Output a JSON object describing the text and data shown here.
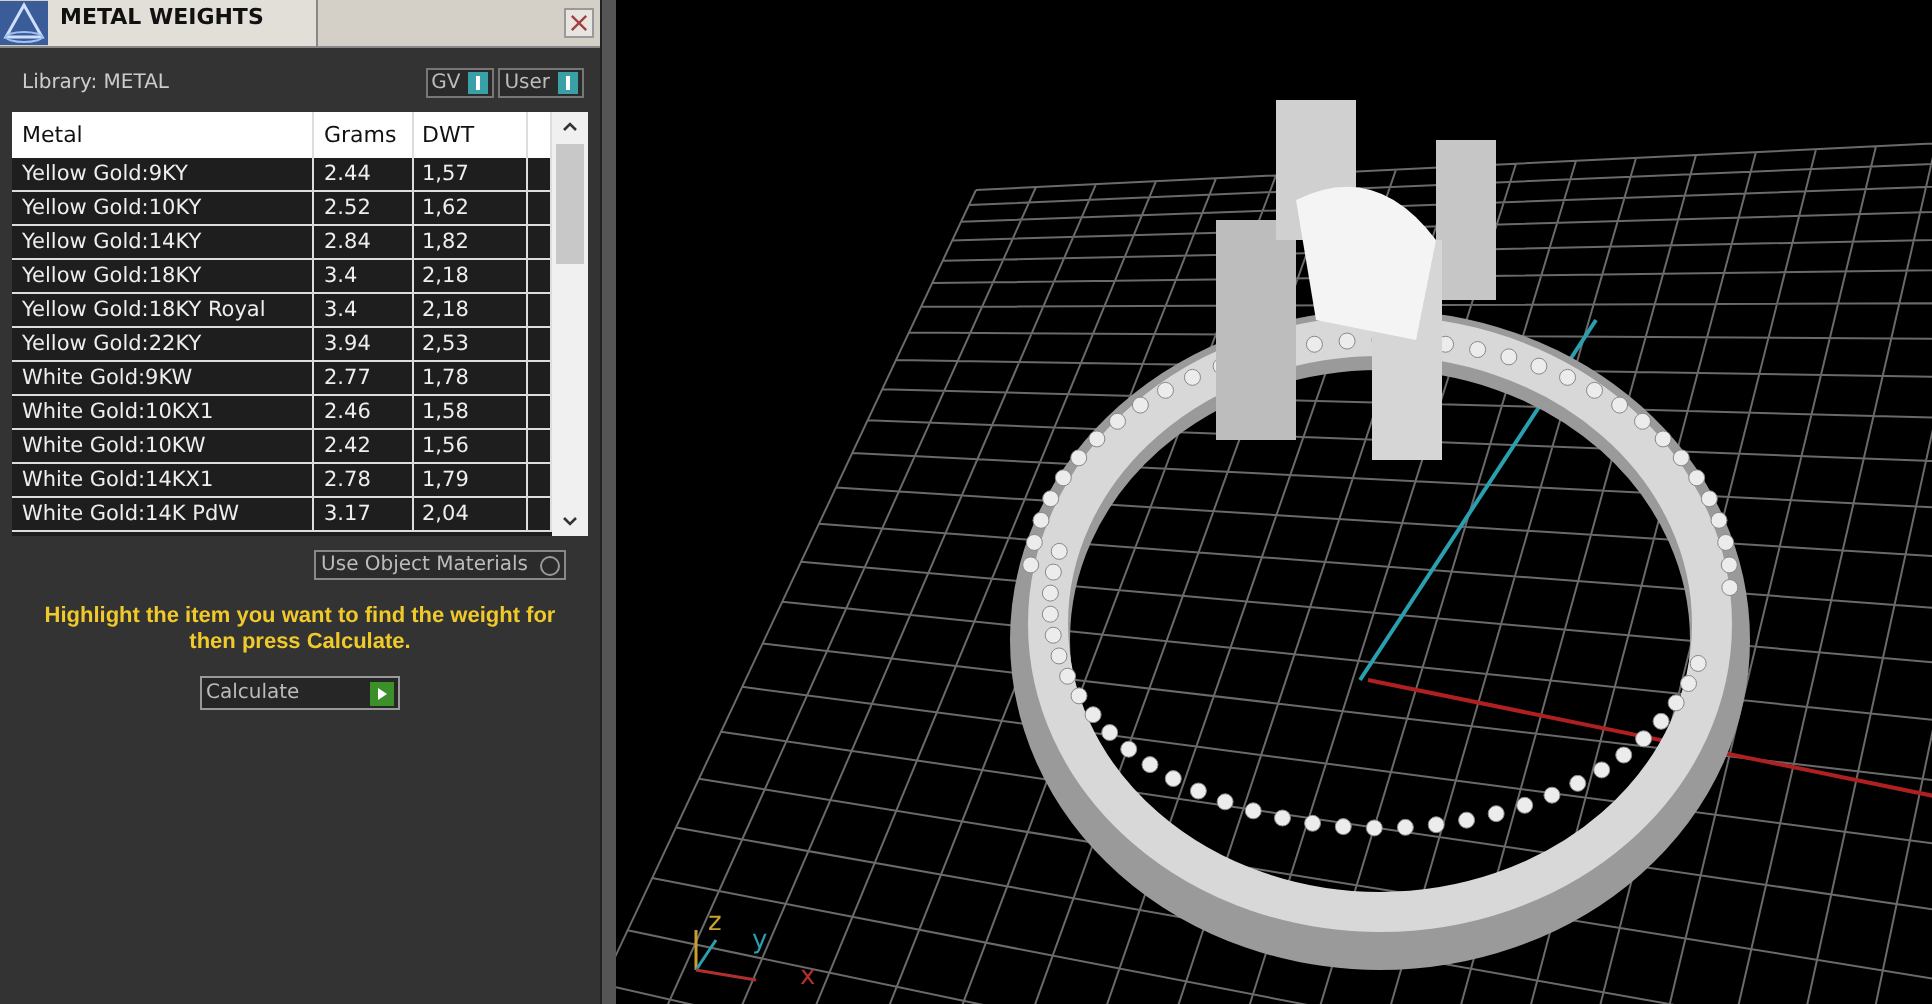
{
  "panel": {
    "title": "METAL WEIGHTS",
    "library_label": "Library: METAL",
    "toggles": [
      {
        "label": "GV",
        "on": true
      },
      {
        "label": "User",
        "on": true
      }
    ],
    "table": {
      "columns": [
        "Metal",
        "Grams",
        "DWT"
      ],
      "rows": [
        {
          "cells": [
            "Yellow Gold:9KY",
            "2.44",
            "1,57"
          ]
        },
        {
          "cells": [
            "Yellow Gold:10KY",
            "2.52",
            "1,62"
          ]
        },
        {
          "cells": [
            "Yellow Gold:14KY",
            "2.84",
            "1,82"
          ]
        },
        {
          "cells": [
            "Yellow Gold:18KY",
            "3.4",
            "2,18"
          ]
        },
        {
          "cells": [
            "Yellow Gold:18KY Royal",
            "3.4",
            "2,18"
          ]
        },
        {
          "cells": [
            "Yellow Gold:22KY",
            "3.94",
            "2,53"
          ]
        },
        {
          "cells": [
            "White Gold:9KW",
            "2.77",
            "1,78"
          ]
        },
        {
          "cells": [
            "White Gold:10KX1",
            "2.46",
            "1,58"
          ]
        },
        {
          "cells": [
            "White Gold:10KW",
            "2.42",
            "1,56"
          ]
        },
        {
          "cells": [
            "White Gold:14KX1",
            "2.78",
            "1,79"
          ]
        },
        {
          "cells": [
            "White Gold:14K PdW",
            "3.17",
            "2,04"
          ]
        }
      ]
    },
    "use_object_materials": {
      "label": "Use Object Materials",
      "on": false
    },
    "hint": "Highlight the item you want to find the weight for then press Calculate.",
    "calculate_button": "Calculate"
  },
  "viewport": {
    "axes": [
      {
        "label": "z"
      },
      {
        "label": "y"
      },
      {
        "label": "x"
      }
    ]
  }
}
